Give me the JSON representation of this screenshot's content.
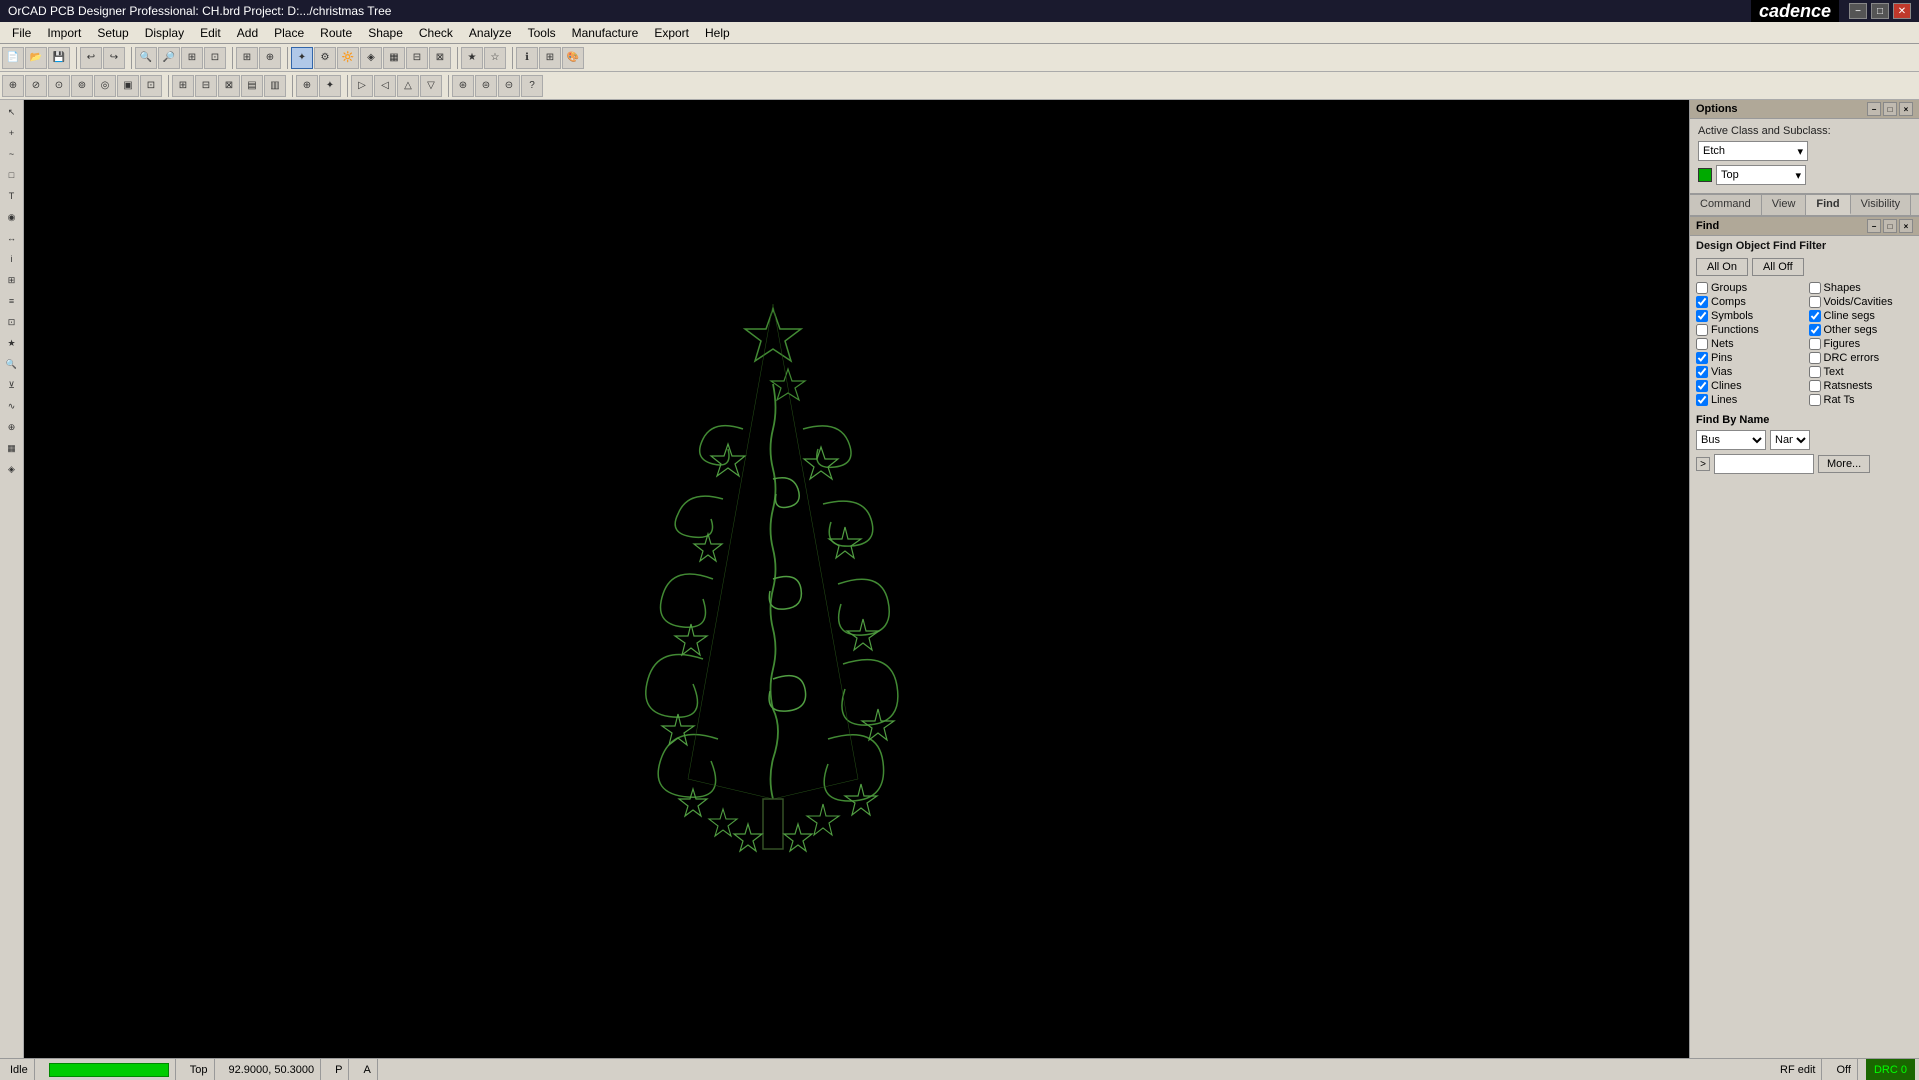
{
  "app": {
    "title": "OrCAD PCB Designer Professional: CH.brd  Project: D:.../christmas Tree",
    "cadence_logo": "cadence"
  },
  "titlebar": {
    "minimize": "−",
    "maximize": "□",
    "close": "✕"
  },
  "menubar": {
    "items": [
      "File",
      "Import",
      "Setup",
      "Display",
      "Edit",
      "Add",
      "Place",
      "Route",
      "Shape",
      "Check",
      "Analyze",
      "Tools",
      "Manufacture",
      "Export",
      "Help"
    ]
  },
  "options_panel": {
    "title": "Options",
    "active_class_label": "Active Class and Subclass:",
    "class_value": "Etch",
    "subclass_value": "Top",
    "color": "#00aa00"
  },
  "tabs": {
    "items": [
      "Command",
      "View",
      "Find",
      "Visibility"
    ],
    "active": "Find"
  },
  "find_panel": {
    "title": "Find",
    "section_label": "Design Object Find Filter",
    "all_on_label": "All On",
    "all_off_label": "All Off",
    "checkboxes": [
      {
        "id": "groups",
        "label": "Groups",
        "checked": false
      },
      {
        "id": "shapes",
        "label": "Shapes",
        "checked": false
      },
      {
        "id": "comps",
        "label": "Comps",
        "checked": true
      },
      {
        "id": "voids",
        "label": "Voids/Cavities",
        "checked": false
      },
      {
        "id": "symbols",
        "label": "Symbols",
        "checked": true
      },
      {
        "id": "clinesegs",
        "label": "Cline segs",
        "checked": true
      },
      {
        "id": "functions",
        "label": "Functions",
        "checked": false
      },
      {
        "id": "othersegs",
        "label": "Other segs",
        "checked": true
      },
      {
        "id": "nets",
        "label": "Nets",
        "checked": false
      },
      {
        "id": "figures",
        "label": "Figures",
        "checked": false
      },
      {
        "id": "pins",
        "label": "Pins",
        "checked": true
      },
      {
        "id": "drcerrors",
        "label": "DRC errors",
        "checked": false
      },
      {
        "id": "vias",
        "label": "Vias",
        "checked": true
      },
      {
        "id": "text",
        "label": "Text",
        "checked": false
      },
      {
        "id": "clines",
        "label": "Clines",
        "checked": true
      },
      {
        "id": "ratsnests",
        "label": "Ratsnests",
        "checked": false
      },
      {
        "id": "lines",
        "label": "Lines",
        "checked": true
      },
      {
        "id": "ratts",
        "label": "Rat Ts",
        "checked": false
      }
    ],
    "find_by_name_label": "Find By Name",
    "bus_value": "Bus",
    "name_value": "Nam",
    "more_label": "More..."
  },
  "statusbar": {
    "idle": "Idle",
    "layer": "Top",
    "coords": "92.9000, 50.3000",
    "p": "P",
    "a": "A",
    "rf_edit": "RF edit",
    "off": "Off",
    "drc": "DRC",
    "drc_count": "0"
  },
  "icons": {
    "dropdown_arrow": "▾",
    "expand": ">",
    "minimize": "−",
    "restore": "□",
    "close": "×"
  }
}
